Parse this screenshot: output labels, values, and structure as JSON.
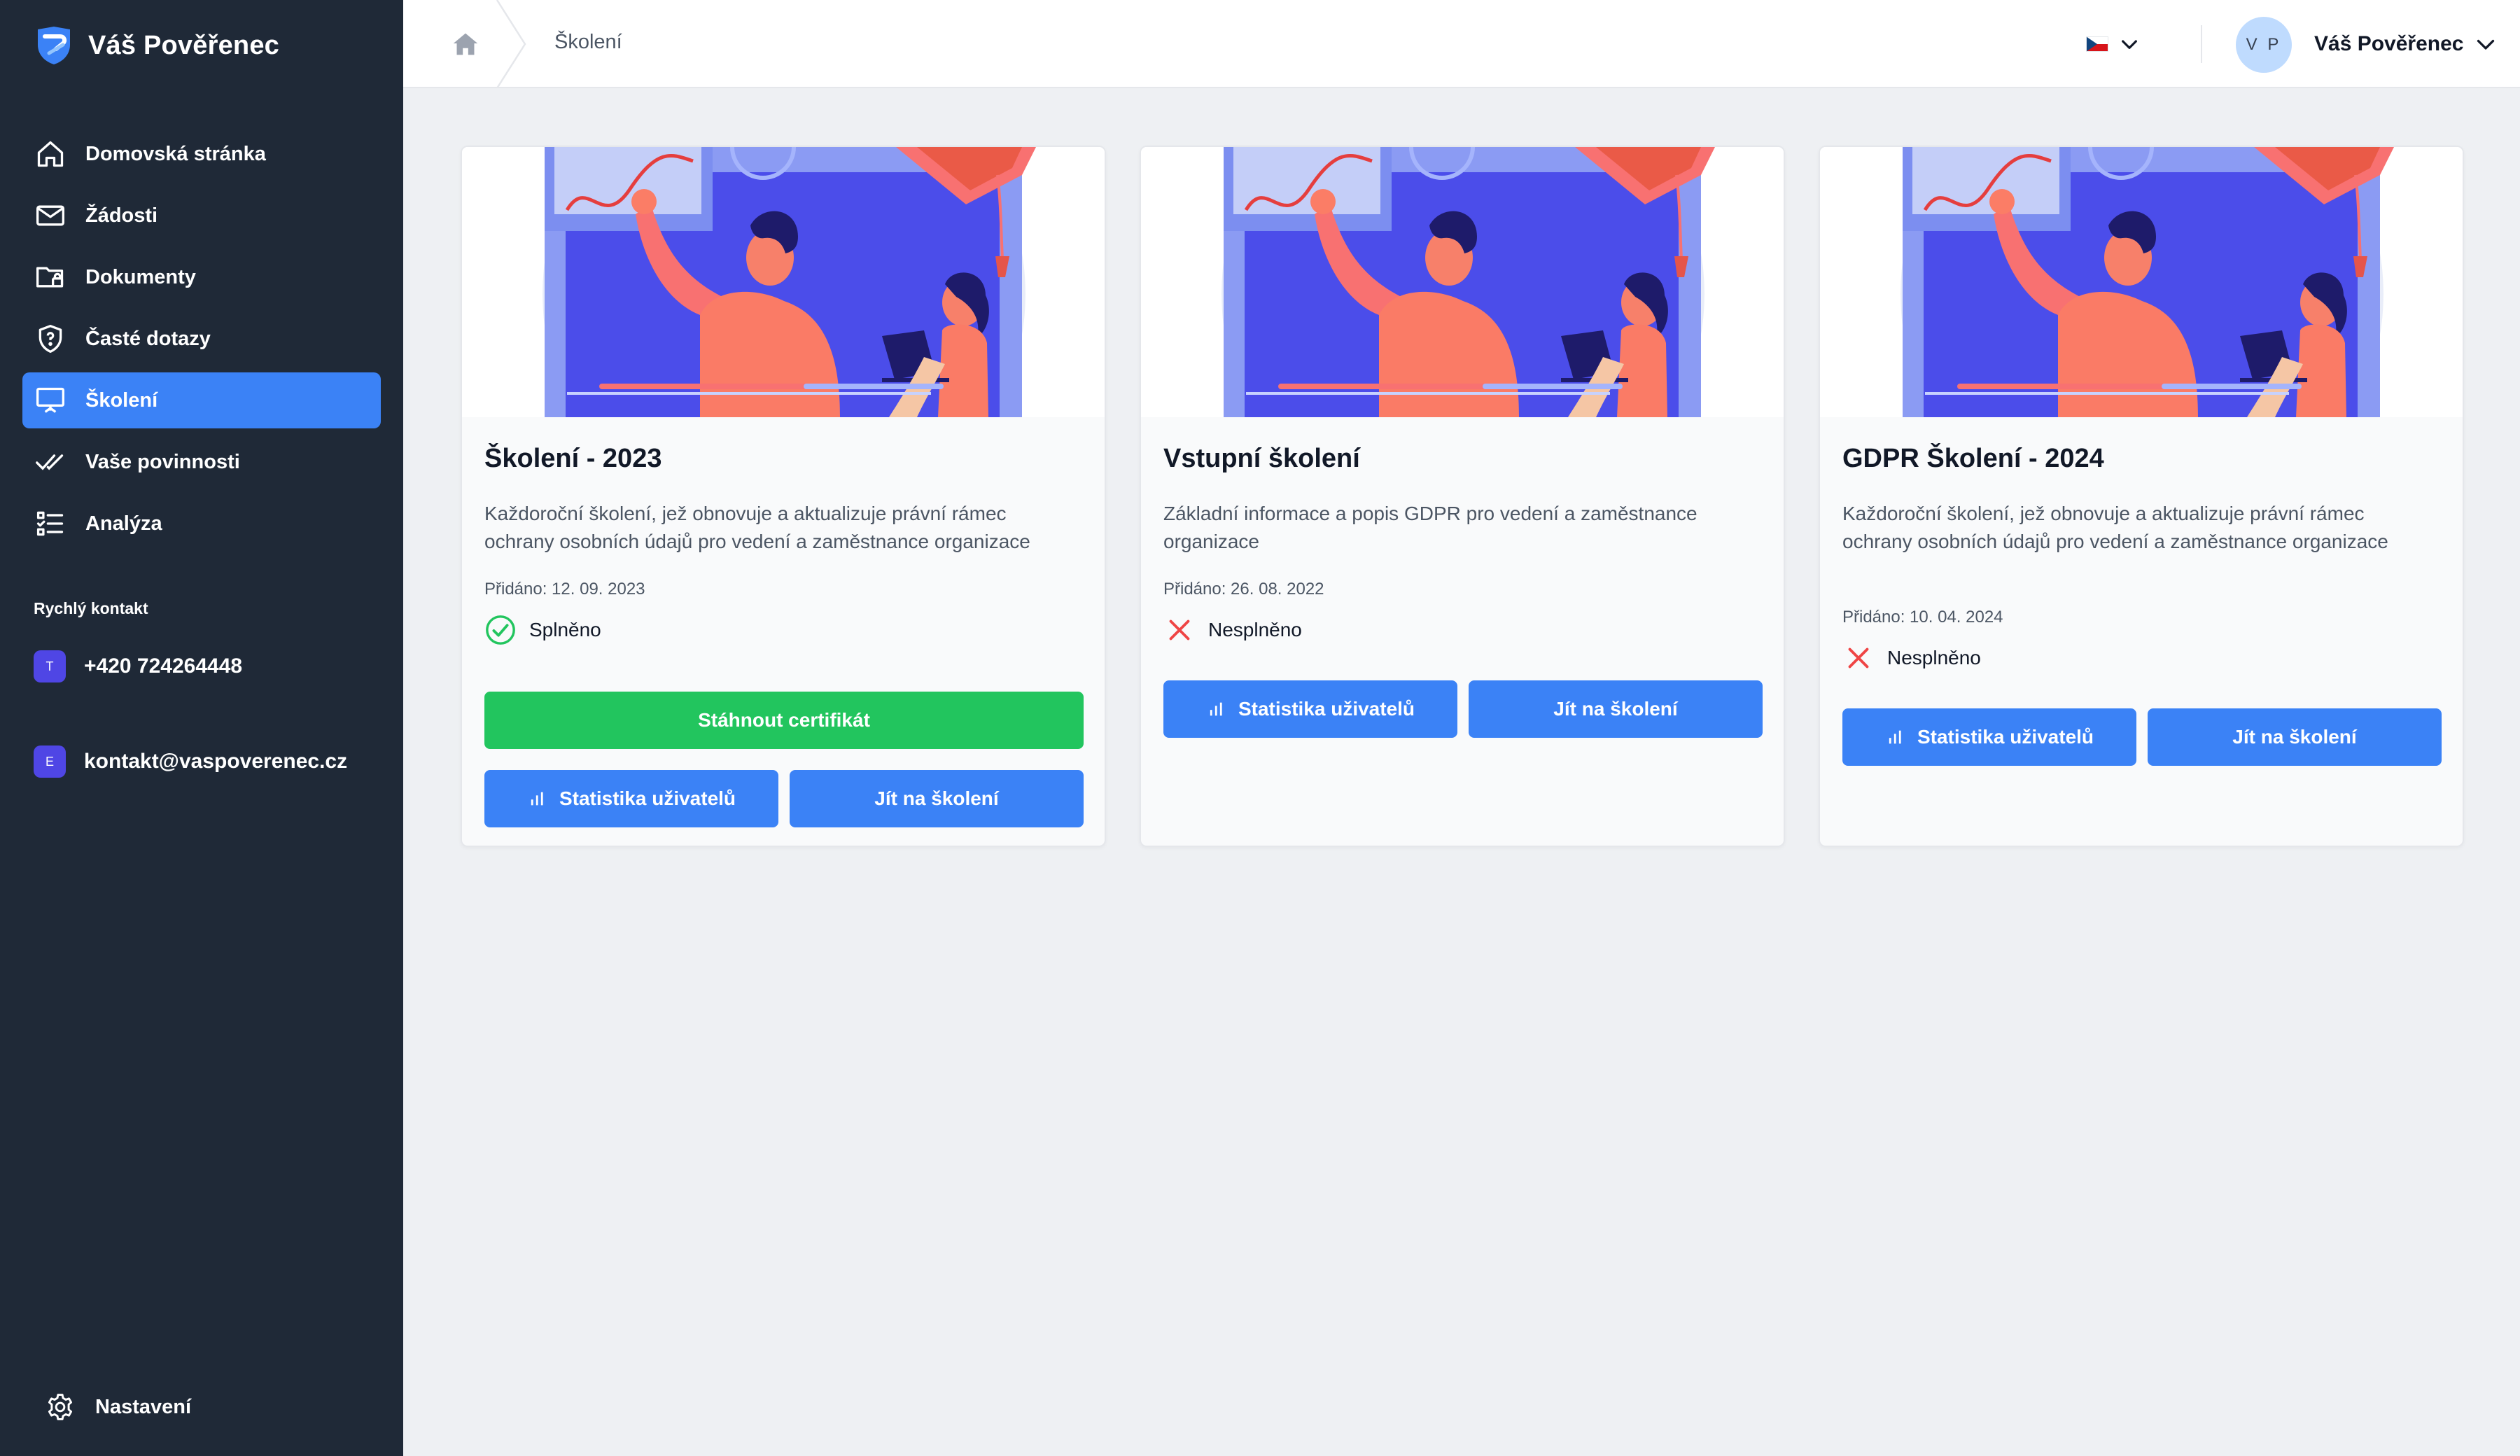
{
  "brand": {
    "name": "Váš Pověřenec"
  },
  "sidebar": {
    "items": [
      {
        "label": "Domovská stránka",
        "icon": "home-icon",
        "active": false
      },
      {
        "label": "Žádosti",
        "icon": "mail-icon",
        "active": false
      },
      {
        "label": "Dokumenty",
        "icon": "folder-lock-icon",
        "active": false
      },
      {
        "label": "Časté dotazy",
        "icon": "shield-question-icon",
        "active": false
      },
      {
        "label": "Školení",
        "icon": "presentation-icon",
        "active": true
      },
      {
        "label": "Vaše povinnosti",
        "icon": "double-check-icon",
        "active": false
      },
      {
        "label": "Analýza",
        "icon": "list-check-icon",
        "active": false
      }
    ],
    "quick_contact_title": "Rychlý kontakt",
    "phone": {
      "badge": "T",
      "text": "+420 724264448"
    },
    "email": {
      "badge": "E",
      "text": "kontakt@vaspoverenec.cz"
    },
    "settings_label": "Nastavení"
  },
  "header": {
    "breadcrumb": "Školení",
    "language_flag": "cz-flag-icon",
    "avatar_initials": "V P",
    "user_name": "Váš Pověřenec"
  },
  "colors": {
    "sidebar_bg": "#1f2937",
    "accent": "#3b82f6",
    "success": "#22c55e",
    "danger": "#ef4444"
  },
  "cards": [
    {
      "title": "Školení - 2023",
      "description": "Každoroční školení, jež obnovuje a aktualizuje právní rámec ochrany osobních údajů pro vedení a zaměstnance organizace",
      "date": "Přidáno: 12. 09. 2023",
      "status": "Splněno",
      "status_icon": "check-circle-icon",
      "download_label": "Stáhnout certifikát",
      "stats_label": "Statistika uživatelů",
      "go_label": "Jít na školení"
    },
    {
      "title": "Vstupní školení",
      "description": "Základní informace a popis GDPR pro vedení a zaměstnance organizace",
      "date": "Přidáno: 26. 08. 2022",
      "status": "Nesplněno",
      "status_icon": "x-icon",
      "stats_label": "Statistika uživatelů",
      "go_label": "Jít na školení"
    },
    {
      "title": "GDPR Školení - 2024",
      "description": "Každoroční školení, jež obnovuje a aktualizuje právní rámec ochrany osobních údajů pro vedení a zaměstnance organizace",
      "date": "Přidáno: 10. 04. 2024",
      "status": "Nesplněno",
      "status_icon": "x-icon",
      "stats_label": "Statistika uživatelů",
      "go_label": "Jít na školení"
    }
  ]
}
